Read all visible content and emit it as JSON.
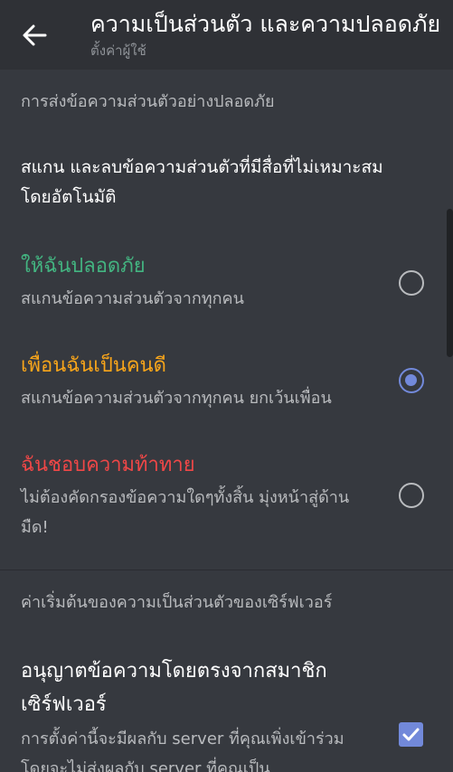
{
  "header": {
    "title": "ความเป็นส่วนตัว และความปลอดภัย",
    "subtitle": "ตั้งค่าผู้ใช้"
  },
  "safe_dm": {
    "section_label": "การส่งข้อความส่วนตัวอย่างปลอดภัย",
    "description": "สแกน และลบข้อความส่วนตัวที่มีสื่อที่ไม่เหมาะสมโดยอัตโนมัติ",
    "options": [
      {
        "title": "ให้ฉันปลอดภัย",
        "subtitle": "สแกนข้อความส่วนตัวจากทุกคน",
        "color": "#43b581",
        "selected": false
      },
      {
        "title": "เพื่อนฉันเป็นคนดี",
        "subtitle": "สแกนข้อความส่วนตัวจากทุกคน ยกเว้นเพื่อน",
        "color": "#faa61a",
        "selected": true
      },
      {
        "title": "ฉันชอบความท้าทาย",
        "subtitle": "ไม่ต้องคัดกรองข้อความใดๆทั้งสิ้น มุ่งหน้าสู่ด้านมืด!",
        "color": "#f04747",
        "selected": false
      }
    ]
  },
  "server_privacy": {
    "section_label": "ค่าเริ่มต้นของความเป็นส่วนตัวของเซิร์ฟเวอร์",
    "toggle_title": "อนุญาตข้อความโดยตรงจากสมาชิกเซิร์ฟเวอร์",
    "toggle_subtitle": "การตั้งค่านี้จะมีผลกับ server ที่คุณเพิ่งเข้าร่วม โดยจะไม่ส่งผลกับ server ที่คุณเป็น",
    "checked": true
  },
  "colors": {
    "accent": "#7289da",
    "background": "#36393f",
    "header": "#2f3136"
  },
  "icons": {
    "back": "arrow-left-icon",
    "check": "checkmark-icon"
  }
}
